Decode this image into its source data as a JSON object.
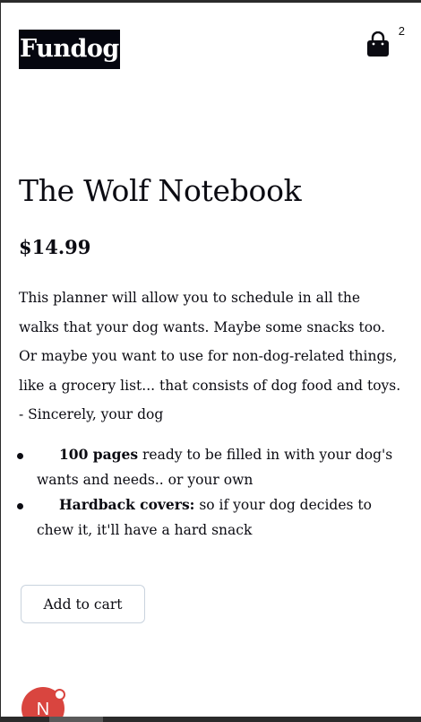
{
  "header": {
    "logo": "Fundog",
    "cart_icon": "shopping-bag-icon",
    "cart_count": "2"
  },
  "product": {
    "title": "The Wolf Notebook",
    "price": "$14.99",
    "description": "This planner will allow you to schedule in all the walks that your dog wants. Maybe some snacks too. Or maybe you want to use for non-dog-related things, like a grocery list... that consists of dog food and toys. - Sincerely, your dog",
    "features": [
      {
        "lead": "100 pages",
        "text": " ready to be filled in with your dog's wants and needs.. or your own"
      },
      {
        "lead": "Hardback covers:",
        "text": " so if your dog decides to chew it, it'll have a hard snack"
      }
    ],
    "add_to_cart_label": "Add to cart"
  },
  "avatar": {
    "initial": "N"
  },
  "colors": {
    "logo_bg": "#05060f",
    "avatar": "#d9453f",
    "button_border": "#c9d3de"
  }
}
